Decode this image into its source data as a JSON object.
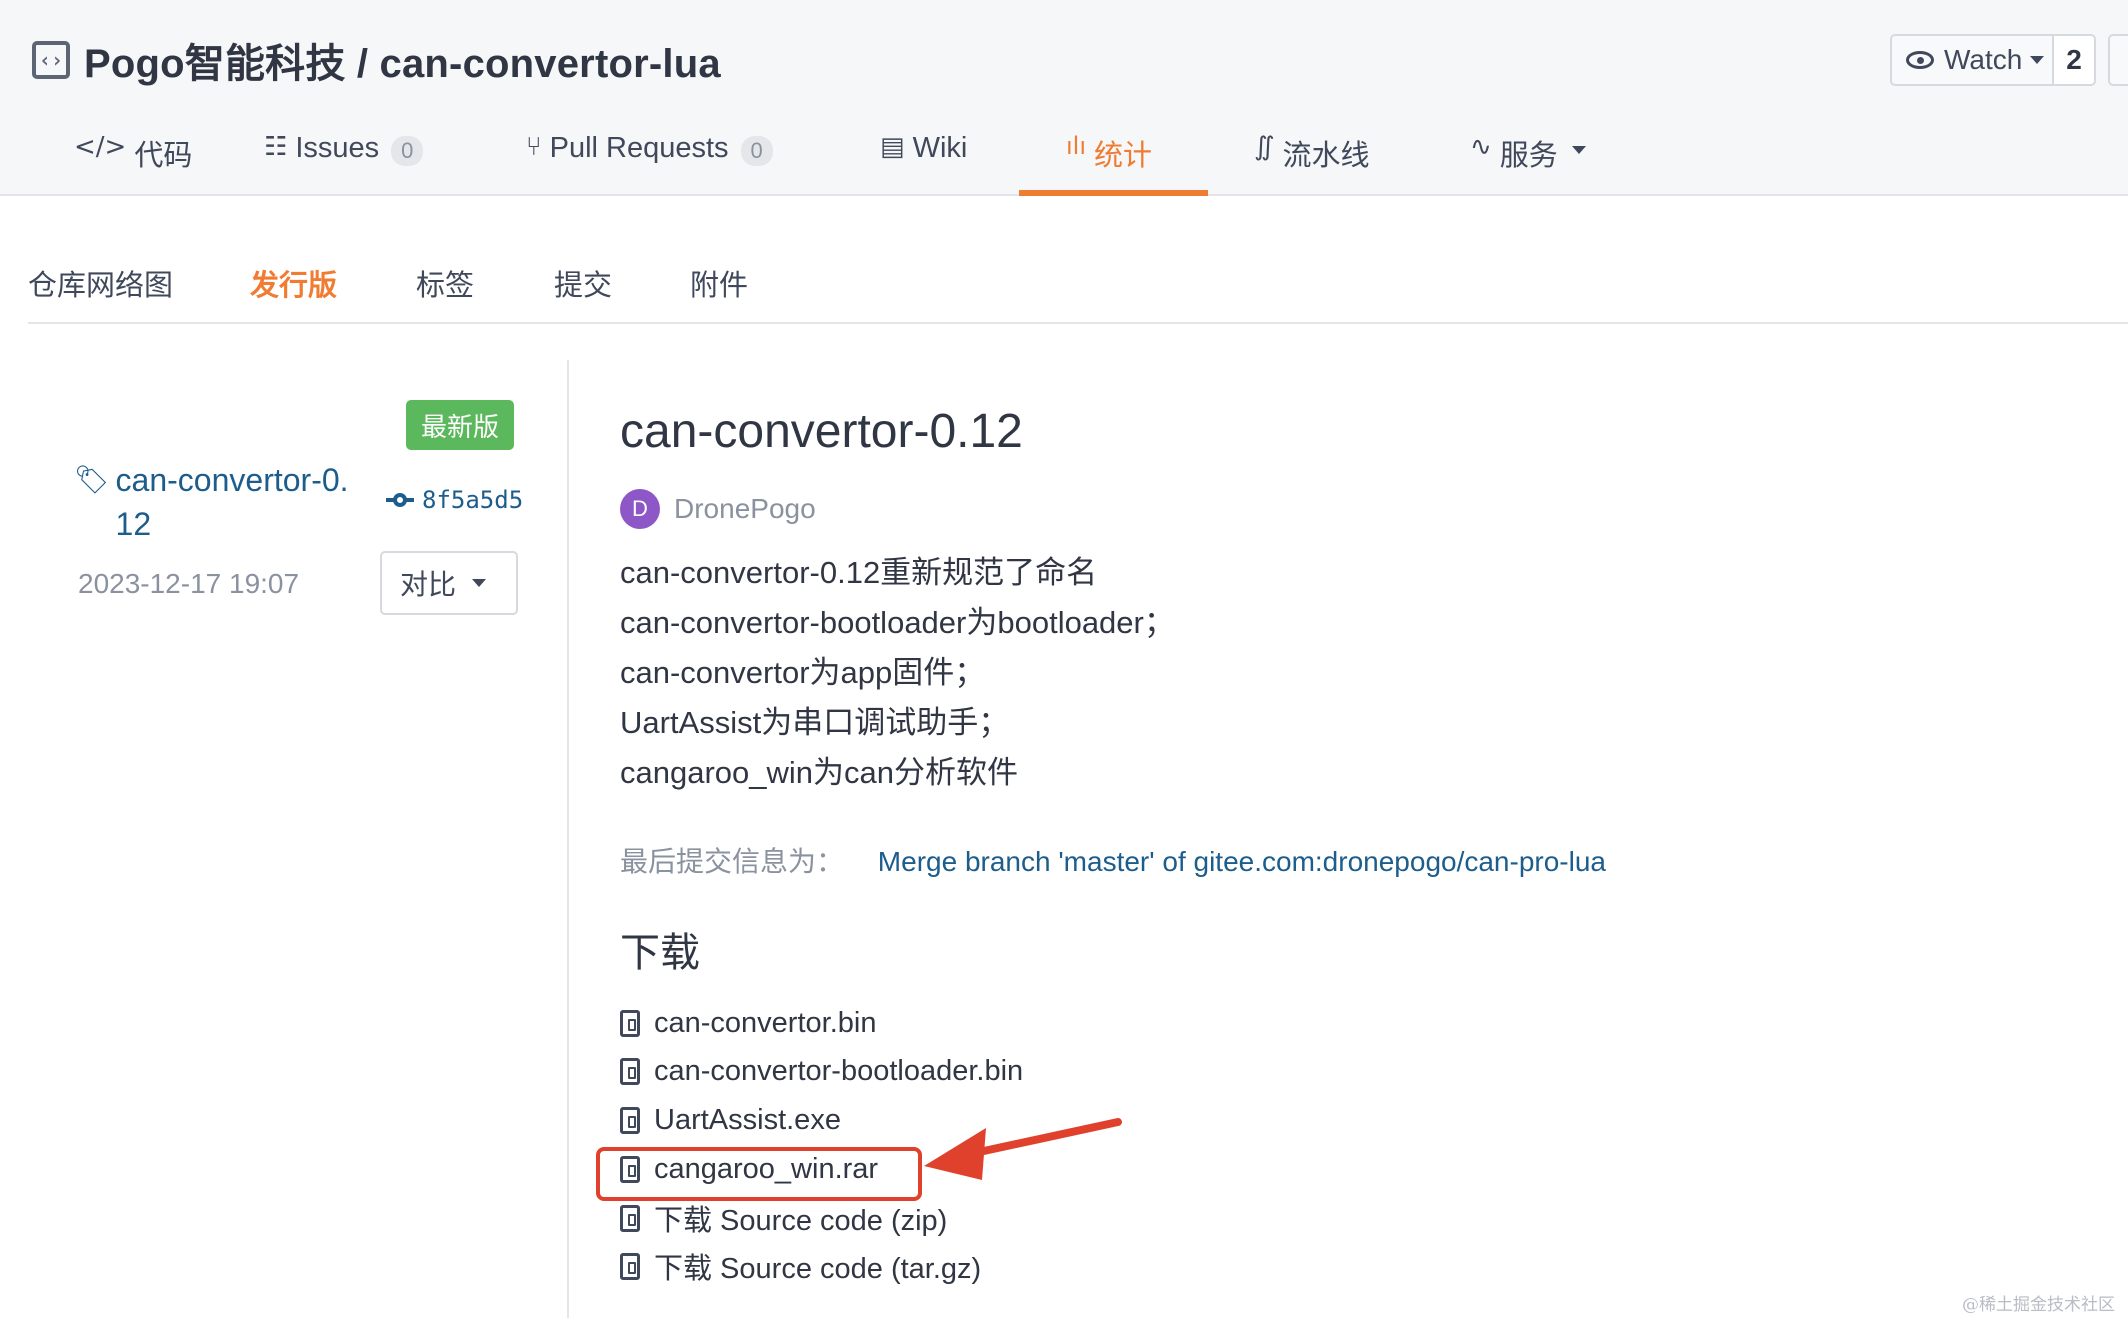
{
  "header": {
    "repo_title": "Pogo智能科技 / can-convertor-lua",
    "repo_icon": "code-box-icon",
    "watch_label": "Watch",
    "watch_count": "2"
  },
  "nav": {
    "tabs": [
      {
        "icon": "</>",
        "label": "代码"
      },
      {
        "icon": "☷",
        "label": "Issues",
        "count": "0"
      },
      {
        "icon": "⑂",
        "label": "Pull Requests",
        "count": "0"
      },
      {
        "icon": "▤",
        "label": "Wiki"
      },
      {
        "icon": "📊",
        "label": "统计"
      },
      {
        "icon": "∬",
        "label": "流水线"
      },
      {
        "icon": "∿",
        "label": "服务"
      }
    ],
    "active_tab": "统计",
    "accent_color": "#f07c33"
  },
  "subnav": {
    "items": [
      "仓库网络图",
      "发行版",
      "标签",
      "提交",
      "附件"
    ],
    "active": "发行版"
  },
  "release_sidebar": {
    "latest_badge": "最新版",
    "tag_line1": "can-convertor-0.",
    "tag_line2": "12",
    "commit_hash": "8f5a5d5",
    "date": "2023-12-17 19:07",
    "compare_label": "对比"
  },
  "release": {
    "title": "can-convertor-0.12",
    "author_initial": "D",
    "author": "DronePogo",
    "notes": [
      "can-convertor-0.12重新规范了命名",
      "can-convertor-bootloader为bootloader；",
      "can-convertor为app固件；",
      "UartAssist为串口调试助手；",
      "cangaroo_win为can分析软件"
    ],
    "last_commit_label": "最后提交信息为：",
    "last_commit_message": "Merge branch 'master' of gitee.com:dronepogo/can-pro-lua",
    "downloads_heading": "下载",
    "downloads": [
      "can-convertor.bin",
      "can-convertor-bootloader.bin",
      "UartAssist.exe",
      "cangaroo_win.rar",
      "下载 Source code (zip)",
      "下载 Source code (tar.gz)"
    ]
  },
  "annotation": {
    "highlighted_item": "cangaroo_win.rar",
    "color": "#e0412c"
  },
  "watermark": "@稀土掘金技术社区"
}
